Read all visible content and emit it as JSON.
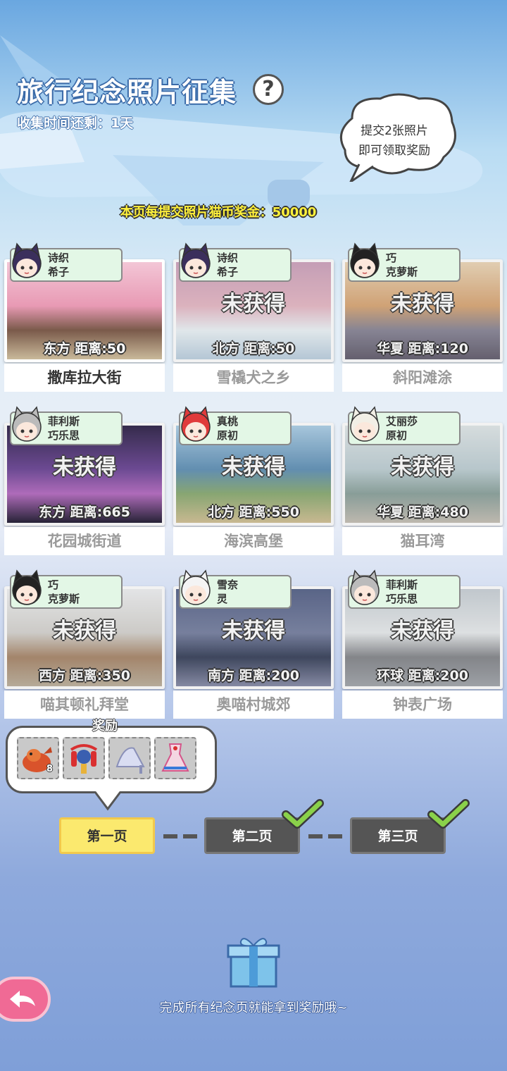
{
  "header": {
    "title": "旅行纪念照片征集",
    "help_glyph": "?",
    "timer": "收集时间还剩：1天",
    "bubble_line1": "提交2张照片",
    "bubble_line2": "即可领取奖励",
    "bonus": "本页每提交照片猫币奖金：50000"
  },
  "cards": [
    {
      "owner1": "诗织",
      "owner2": "希子",
      "locked_text": "",
      "distance": "东方  距离:50",
      "name": "撒库拉大街",
      "obtained": true,
      "scene": "sakura",
      "avatar_hair": "#3b2f5c"
    },
    {
      "owner1": "诗织",
      "owner2": "希子",
      "locked_text": "未获得",
      "distance": "北方  距离:50",
      "name": "雪橇犬之乡",
      "obtained": false,
      "scene": "ice",
      "avatar_hair": "#3b2f5c"
    },
    {
      "owner1": "巧",
      "owner2": "克萝斯",
      "locked_text": "未获得",
      "distance": "华夏  距离:120",
      "name": "斜阳滩涂",
      "obtained": false,
      "scene": "sunset",
      "avatar_hair": "#222"
    },
    {
      "owner1": "菲利斯",
      "owner2": "巧乐思",
      "locked_text": "未获得",
      "distance": "东方  距离:665",
      "name": "花园城街道",
      "obtained": false,
      "scene": "night",
      "avatar_hair": "#bbb"
    },
    {
      "owner1": "真桃",
      "owner2": "原初",
      "locked_text": "未获得",
      "distance": "北方  距离:550",
      "name": "海滨高堡",
      "obtained": false,
      "scene": "coast",
      "avatar_hair": "#e03b3b"
    },
    {
      "owner1": "艾丽莎",
      "owner2": "原初",
      "locked_text": "未获得",
      "distance": "华夏  距离:480",
      "name": "猫耳湾",
      "obtained": false,
      "scene": "bay",
      "avatar_hair": "#f2efe6"
    },
    {
      "owner1": "巧",
      "owner2": "克萝斯",
      "locked_text": "未获得",
      "distance": "西方  距离:350",
      "name": "喵其顿礼拜堂",
      "obtained": false,
      "scene": "church",
      "avatar_hair": "#222"
    },
    {
      "owner1": "雪奈",
      "owner2": "灵",
      "locked_text": "未获得",
      "distance": "南方  距离:200",
      "name": "奥喵村城郊",
      "obtained": false,
      "scene": "dusk",
      "avatar_hair": "#f4f4f4"
    },
    {
      "owner1": "菲利斯",
      "owner2": "巧乐思",
      "locked_text": "未获得",
      "distance": "环球  距离:200",
      "name": "钟表广场",
      "obtained": false,
      "scene": "town",
      "avatar_hair": "#bbb"
    }
  ],
  "rewards": {
    "title": "奖励",
    "first_item_count": "8",
    "items": [
      "lobster-food-icon",
      "lantern-decoration-icon",
      "glass-slipper-icon",
      "dress-costume-icon"
    ]
  },
  "pages": [
    {
      "label": "第一页",
      "selected": true,
      "completed": false
    },
    {
      "label": "第二页",
      "selected": false,
      "completed": true
    },
    {
      "label": "第三页",
      "selected": false,
      "completed": true
    }
  ],
  "footer": {
    "text": "完成所有纪念页就能拿到奖励哦~"
  },
  "colors": {
    "tag_bg": "#e3f7e6",
    "selected_page": "#fbe96e",
    "page_button": "#555555",
    "check": "#8ad14a",
    "back_button": "#f06a95"
  }
}
